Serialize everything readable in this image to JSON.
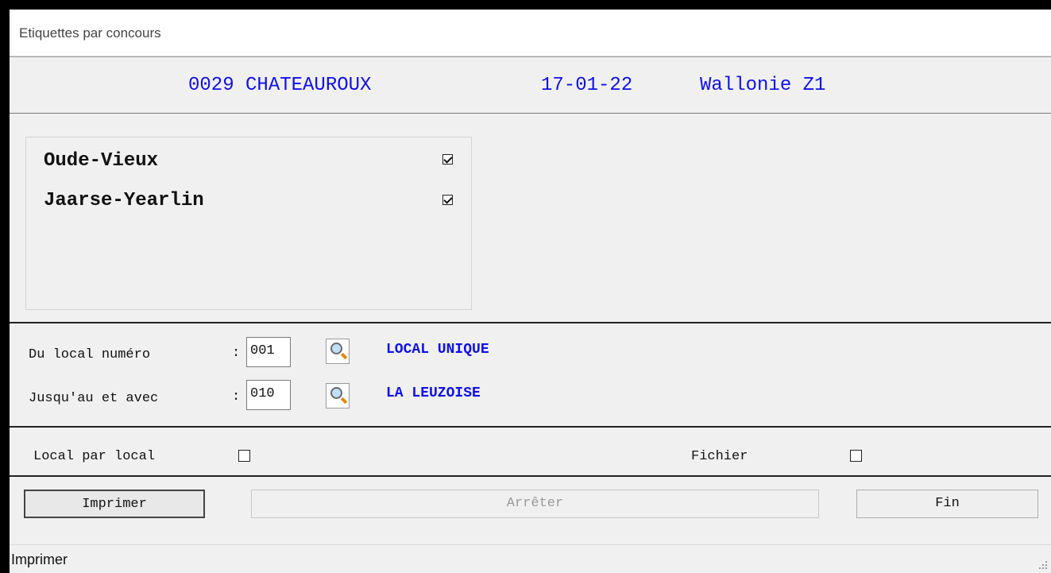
{
  "window": {
    "title": "Etiquettes par concours"
  },
  "header": {
    "contest": "0029 CHATEAUROUX",
    "date": "17-01-22",
    "region": "Wallonie Z1"
  },
  "categories": [
    {
      "label": "Oude-Vieux",
      "checked": true
    },
    {
      "label": "Jaarse-Yearlin",
      "checked": true
    }
  ],
  "range": {
    "from": {
      "label": "Du local numéro",
      "sep": ":",
      "value": "001",
      "name": "LOCAL UNIQUE"
    },
    "to": {
      "label": "Jusqu'au et avec",
      "sep": ":",
      "value": "010",
      "name": "LA LEUZOISE"
    }
  },
  "options": {
    "local_par_local": {
      "label": "Local par local",
      "checked": false
    },
    "fichier": {
      "label": "Fichier",
      "checked": false
    }
  },
  "buttons": {
    "print": "Imprimer",
    "stop": "Arrêter",
    "end": "Fin"
  },
  "status": {
    "text": "Imprimer"
  },
  "colors": {
    "accent_blue": "#1010e8",
    "background": "#f0f0f0"
  }
}
